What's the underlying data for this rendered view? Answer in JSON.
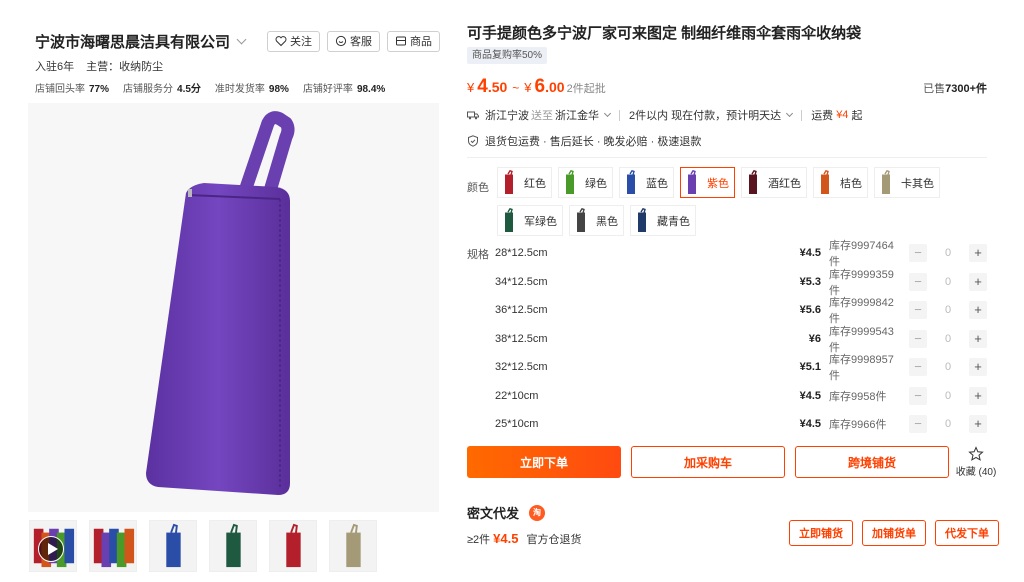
{
  "shop": {
    "name": "宁波市海曙思晨洁具有限公司",
    "follow_label": "关注",
    "service_label": "客服",
    "products_label": "商品",
    "years": "入驻6年",
    "main_business": "主营：收纳防尘",
    "stats": [
      {
        "label": "店铺回头率",
        "value": "77%"
      },
      {
        "label": "店铺服务分",
        "value": "4.5分"
      },
      {
        "label": "准时发货率",
        "value": "98%"
      },
      {
        "label": "店铺好评率",
        "value": "98.4%"
      }
    ]
  },
  "product": {
    "title": "可手提颜色多宁波厂家可来图定 制细纤维雨伞套雨伞收纳袋",
    "repeat_rate": "商品复购率50%",
    "currency": "¥",
    "price_low_int": "4",
    "price_low_dec": ".50",
    "price_high_int": "6",
    "price_high_dec": ".00",
    "tilde": "~",
    "moq": "2件起批",
    "sold_prefix": "已售",
    "sold_value": "7300+件",
    "ship_from": "浙江宁波",
    "ship_to_word": "送至",
    "ship_to": "浙江金华",
    "delivery": "2件以内  现在付款，预计明天达",
    "freight_label": "运费",
    "freight_value": "¥4",
    "freight_suffix": "起",
    "guarantees": "退货包运费 · 售后延长 · 晚发必赔 · 极速退款"
  },
  "colors": {
    "label": "颜色",
    "options": [
      {
        "label": "红色",
        "color": "#b3202b",
        "selected": false
      },
      {
        "label": "绿色",
        "color": "#4a9a2a",
        "selected": false
      },
      {
        "label": "蓝色",
        "color": "#2a4ea8",
        "selected": false
      },
      {
        "label": "紫色",
        "color": "#6a3fb0",
        "selected": true
      },
      {
        "label": "酒红色",
        "color": "#5a1420",
        "selected": false
      },
      {
        "label": "桔色",
        "color": "#d2561c",
        "selected": false
      },
      {
        "label": "卡其色",
        "color": "#a49a78",
        "selected": false
      },
      {
        "label": "军绿色",
        "color": "#1f5a40",
        "selected": false
      },
      {
        "label": "黑色",
        "color": "#444444",
        "selected": false
      },
      {
        "label": "藏青色",
        "color": "#203a6a",
        "selected": false
      }
    ]
  },
  "specs": {
    "label": "规格",
    "rows": [
      {
        "size": "28*12.5cm",
        "price": "¥4.5",
        "stock": "库存9997464件",
        "qty": "0"
      },
      {
        "size": "34*12.5cm",
        "price": "¥5.3",
        "stock": "库存9999359件",
        "qty": "0"
      },
      {
        "size": "36*12.5cm",
        "price": "¥5.6",
        "stock": "库存9999842件",
        "qty": "0"
      },
      {
        "size": "38*12.5cm",
        "price": "¥6",
        "stock": "库存9999543件",
        "qty": "0"
      },
      {
        "size": "32*12.5cm",
        "price": "¥5.1",
        "stock": "库存9998957件",
        "qty": "0"
      },
      {
        "size": "22*10cm",
        "price": "¥4.5",
        "stock": "库存9958件",
        "qty": "0"
      },
      {
        "size": "25*10cm",
        "price": "¥4.5",
        "stock": "库存9966件",
        "qty": "0"
      }
    ]
  },
  "actions": {
    "order": "立即下单",
    "cart": "加采购车",
    "cross_border": "跨境铺货",
    "favorite": "收藏 (40)"
  },
  "dropship": {
    "title": "密文代发",
    "badge": "淘",
    "min_qty": "≥2件",
    "price": "¥4.5",
    "return_note": "官方仓退货",
    "btn_list": "立即铺货",
    "btn_add": "加铺货单",
    "btn_order": "代发下单"
  },
  "thumbs": [
    {
      "kind": "video",
      "colors": [
        "#b3202b",
        "#d2561c",
        "#6a3fb0",
        "#4a9a2a",
        "#2a4ea8"
      ]
    },
    {
      "kind": "image",
      "colors": [
        "#b3202b",
        "#6a3fb0",
        "#2a4ea8",
        "#4a9a2a",
        "#d2561c"
      ]
    },
    {
      "kind": "image",
      "colors": [
        "#2a4ea8"
      ]
    },
    {
      "kind": "image",
      "colors": [
        "#1f5a40"
      ]
    },
    {
      "kind": "image",
      "colors": [
        "#b3202b"
      ]
    },
    {
      "kind": "image",
      "colors": [
        "#a49a78"
      ]
    }
  ],
  "main_image_color": "#6a3fb0"
}
